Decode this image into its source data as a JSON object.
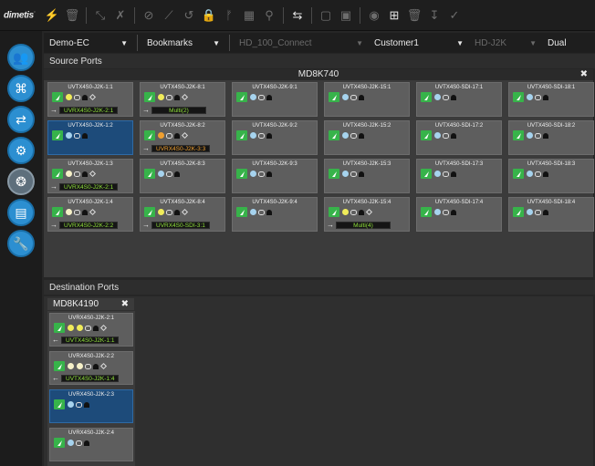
{
  "app": {
    "logo": "dimetis",
    "logo_mark": "·"
  },
  "toolbar": {
    "icons": [
      "plug-icon",
      "trash-icon",
      "collapse-icon",
      "disconnect-icon",
      "block-icon",
      "chart-icon",
      "undo-icon",
      "lock-icon",
      "pin-icon",
      "grid-icon",
      "tag-icon",
      "swap-icon",
      "document-icon",
      "document2-icon",
      "eye-icon",
      "plus-icon",
      "delete-icon",
      "download-icon",
      "check-icon"
    ]
  },
  "sidebar": {
    "items": [
      "users",
      "ports",
      "connections",
      "settings",
      "network",
      "display",
      "tools"
    ]
  },
  "filters": {
    "domain": "Demo-EC",
    "bookmarks": "Bookmarks",
    "preset": "HD_100_Connect",
    "customer": "Customer1",
    "codec": "HD-J2K",
    "mode": "Dual"
  },
  "source": {
    "section_label": "Source Ports",
    "panel_title": "MD8K740",
    "tiles": [
      {
        "name": "UVTX4S0-J2K-1:1",
        "conn": "UVRX4S0-J2K-2:1",
        "dots": [
          "#f0ec5a"
        ],
        "diamond": true,
        "sel": false,
        "orange": false
      },
      {
        "name": "UVTX4S0-J2K-8:1",
        "conn": "Multi(2)",
        "dots": [
          "#f0ec5a"
        ],
        "diamond": true,
        "sel": false,
        "orange": false
      },
      {
        "name": "UVTX4S0-J2K-9:1",
        "conn": "",
        "dots": [
          "#a6d3ee"
        ],
        "diamond": false,
        "sel": false,
        "orange": false
      },
      {
        "name": "UVTX4S0-J2K-15:1",
        "conn": "",
        "dots": [
          "#a6d3ee"
        ],
        "diamond": false,
        "sel": false,
        "orange": false
      },
      {
        "name": "UVTX4S0-SDI-17:1",
        "conn": "",
        "dots": [
          "#a6d3ee"
        ],
        "diamond": false,
        "sel": false,
        "orange": false
      },
      {
        "name": "UVTX4S0-SDI-18:1",
        "conn": "",
        "dots": [
          "#a6d3ee"
        ],
        "diamond": false,
        "sel": false,
        "orange": false
      },
      {
        "name": "UVTX4S0-J2K-1:2",
        "conn": "",
        "dots": [
          "#a6d3ee"
        ],
        "diamond": false,
        "sel": true,
        "orange": false
      },
      {
        "name": "UVTX4S0-J2K-8:2",
        "conn": "UVRX4S0-J2K-3:3",
        "dots": [
          "#f0a030"
        ],
        "diamond": true,
        "sel": false,
        "orange": true
      },
      {
        "name": "UVTX4S0-J2K-9:2",
        "conn": "",
        "dots": [
          "#a6d3ee"
        ],
        "diamond": false,
        "sel": false,
        "orange": false
      },
      {
        "name": "UVTX4S0-J2K-15:2",
        "conn": "",
        "dots": [
          "#a6d3ee"
        ],
        "diamond": false,
        "sel": false,
        "orange": false
      },
      {
        "name": "UVTX4S0-SDI-17:2",
        "conn": "",
        "dots": [
          "#a6d3ee"
        ],
        "diamond": false,
        "sel": false,
        "orange": false
      },
      {
        "name": "UVTX4S0-SDI-18:2",
        "conn": "",
        "dots": [
          "#a6d3ee"
        ],
        "diamond": false,
        "sel": false,
        "orange": false
      },
      {
        "name": "UVTX4S0-J2K-1:3",
        "conn": "UVRX4S0-J2K-2:1",
        "dots": [
          "#f5f0c8"
        ],
        "diamond": true,
        "sel": false,
        "orange": false
      },
      {
        "name": "UVTX4S0-J2K-8:3",
        "conn": "",
        "dots": [
          "#a6d3ee"
        ],
        "diamond": false,
        "sel": false,
        "orange": false
      },
      {
        "name": "UVTX4S0-J2K-9:3",
        "conn": "",
        "dots": [
          "#a6d3ee"
        ],
        "diamond": false,
        "sel": false,
        "orange": false
      },
      {
        "name": "UVTX4S0-J2K-15:3",
        "conn": "",
        "dots": [
          "#a6d3ee"
        ],
        "diamond": false,
        "sel": false,
        "orange": false
      },
      {
        "name": "UVTX4S0-SDI-17:3",
        "conn": "",
        "dots": [
          "#a6d3ee"
        ],
        "diamond": false,
        "sel": false,
        "orange": false
      },
      {
        "name": "UVTX4S0-SDI-18:3",
        "conn": "",
        "dots": [
          "#a6d3ee"
        ],
        "diamond": false,
        "sel": false,
        "orange": false
      },
      {
        "name": "UVTX4S0-J2K-1:4",
        "conn": "UVRX4S0-J2K-2:2",
        "dots": [
          "#f5f0c8"
        ],
        "diamond": true,
        "sel": false,
        "orange": false
      },
      {
        "name": "UVTX4S0-J2K-8:4",
        "conn": "UVRX4S0-SDI-3:1",
        "dots": [
          "#f0ec5a"
        ],
        "diamond": true,
        "sel": false,
        "orange": false
      },
      {
        "name": "UVTX4S0-J2K-9:4",
        "conn": "",
        "dots": [
          "#a6d3ee"
        ],
        "diamond": false,
        "sel": false,
        "orange": false
      },
      {
        "name": "UVTX4S0-J2K-15:4",
        "conn": "Multi(4)",
        "dots": [
          "#f0ec5a"
        ],
        "diamond": true,
        "sel": false,
        "orange": false
      },
      {
        "name": "UVTX4S0-SDI-17:4",
        "conn": "",
        "dots": [
          "#a6d3ee"
        ],
        "diamond": false,
        "sel": false,
        "orange": false
      },
      {
        "name": "UVTX4S0-SDI-18:4",
        "conn": "",
        "dots": [
          "#a6d3ee"
        ],
        "diamond": false,
        "sel": false,
        "orange": false
      }
    ]
  },
  "destination": {
    "section_label": "Destination Ports",
    "tab_label": "MD8K4190",
    "tiles": [
      {
        "name": "UVRX4S0-J2K-2:1",
        "conn": "UVTX4S0-J2K-1:1",
        "dots": [
          "#f0ec5a",
          "#f0ec5a"
        ],
        "diamond": true,
        "sel": false
      },
      {
        "name": "UVRX4S0-J2K-2:2",
        "conn": "UVTX4S0-J2K-1:4",
        "dots": [
          "#f5f0c8",
          "#f5f0c8"
        ],
        "diamond": true,
        "sel": false
      },
      {
        "name": "UVRX4S0-J2K-2:3",
        "conn": "",
        "dots": [
          "#a6d3ee"
        ],
        "diamond": false,
        "sel": true
      },
      {
        "name": "UVRX4S0-J2K-2:4",
        "conn": "",
        "dots": [
          "#a6d3ee"
        ],
        "diamond": false,
        "sel": false
      }
    ]
  }
}
